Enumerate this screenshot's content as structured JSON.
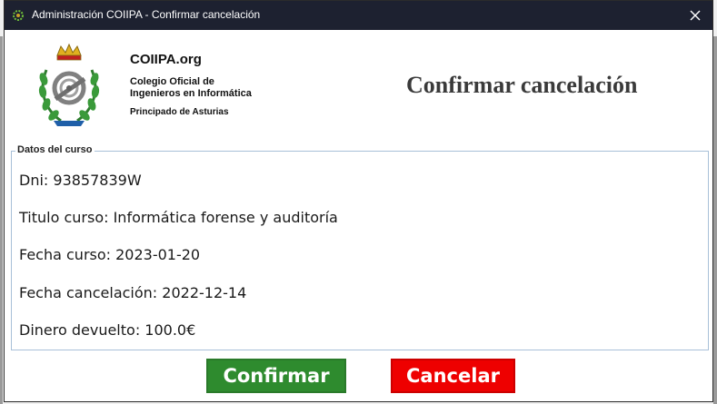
{
  "window": {
    "title": "Administración COIIPA - Confirmar cancelación",
    "close_glyph": "✕"
  },
  "header": {
    "org_name": "COIIPA.org",
    "org_line1": "Colegio Oficial de",
    "org_line2": "Ingenieros en Informática",
    "org_region": "Principado de Asturias",
    "heading": "Confirmar cancelación"
  },
  "course": {
    "legend": "Datos del curso",
    "dni": "Dni: 93857839W",
    "title": "Titulo curso: Informática forense y auditoría",
    "date": "Fecha curso: 2023-01-20",
    "cancel_date": "Fecha cancelación: 2022-12-14",
    "refund": "Dinero devuelto: 100.0€"
  },
  "actions": {
    "confirm_label": "Confirmar",
    "cancel_label": "Cancelar"
  },
  "colors": {
    "titlebar": "#1d2130",
    "confirm": "#2e8b2e",
    "cancel": "#ee0000"
  },
  "icons": {
    "app": "gear-icon",
    "close": "close-icon",
    "logo": "coiipa-crest-logo"
  }
}
